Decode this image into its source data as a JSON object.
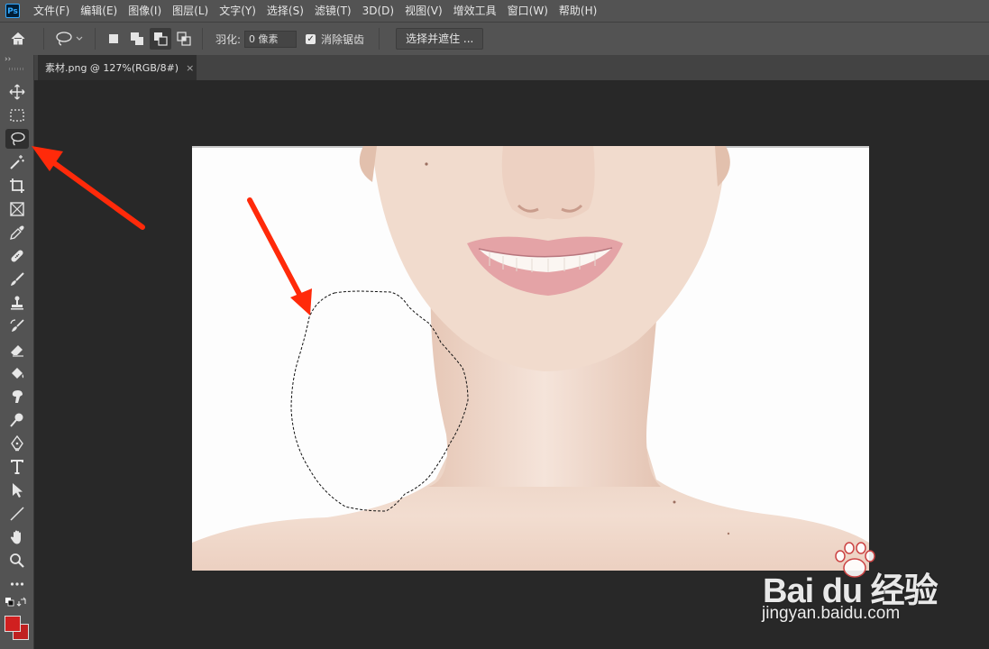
{
  "app": {
    "logo": "Ps"
  },
  "menu": [
    "文件(F)",
    "编辑(E)",
    "图像(I)",
    "图层(L)",
    "文字(Y)",
    "选择(S)",
    "滤镜(T)",
    "3D(D)",
    "视图(V)",
    "增效工具",
    "窗口(W)",
    "帮助(H)"
  ],
  "options": {
    "feather_label": "羽化:",
    "feather_value": "0 像素",
    "antialias_label": "消除锯齿",
    "antialias_checked": "✓",
    "select_mask": "选择并遮住 ..."
  },
  "toolbox": {
    "collapse": "››"
  },
  "document": {
    "tab_title": "素材.png @ 127%(RGB/8#)",
    "close": "×"
  },
  "watermark": {
    "logo": "Bai du 经验",
    "url": "jingyan.baidu.com"
  },
  "colors": {
    "foreground": "#d02020",
    "background": "#c02020",
    "annotation_arrow": "#ff2a0a",
    "ui_bar": "#535353",
    "workspace": "#282828"
  }
}
